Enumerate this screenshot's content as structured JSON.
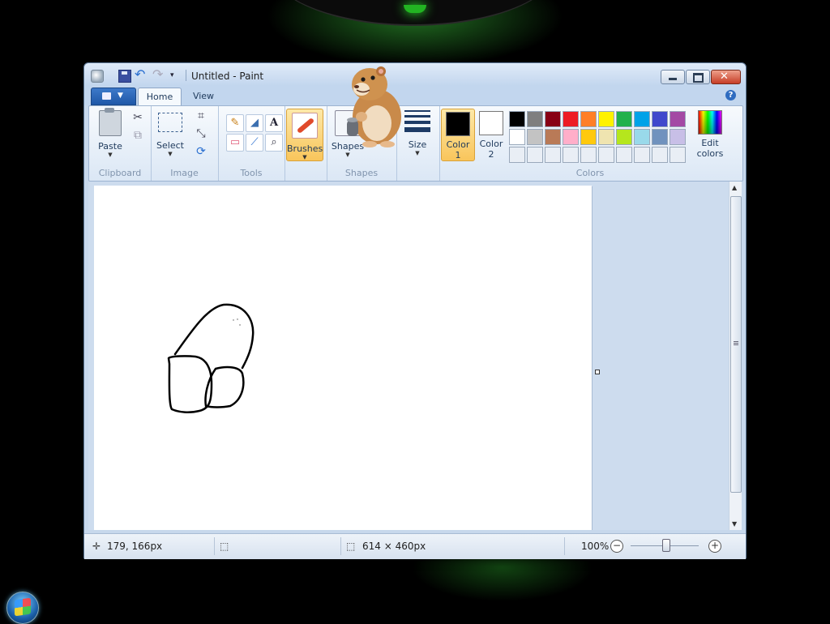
{
  "window": {
    "title": "Untitled - Paint",
    "close_glyph": "✕"
  },
  "quick_access": {
    "undo_icon": "↶",
    "redo_icon": "↷",
    "dropdown_icon": "▾"
  },
  "tabs": [
    {
      "label": "Home",
      "active": true
    },
    {
      "label": "View",
      "active": false
    }
  ],
  "help_label": "?",
  "ribbon": {
    "clipboard": {
      "group_label": "Clipboard",
      "paste_label": "Paste",
      "cut_icon": "✂",
      "copy_icon": "⧉"
    },
    "image": {
      "group_label": "Image",
      "select_label": "Select",
      "crop_icon": "⌗",
      "resize_icon": "⤡",
      "rotate_icon": "⟳"
    },
    "tools": {
      "group_label": "Tools",
      "pencil_icon": "✎",
      "fill_icon": "◢",
      "text_icon": "A",
      "eraser_icon": "▭",
      "picker_icon": "⟋",
      "magnifier_icon": "⌕"
    },
    "brushes_label": "Brushes",
    "shapes": {
      "group_label": "Shapes",
      "button_label": "Shapes"
    },
    "size_label": "Size",
    "colors": {
      "group_label": "Colors",
      "color1_label_line1": "Color",
      "color1_label_line2": "1",
      "color2_label_line1": "Color",
      "color2_label_line2": "2",
      "color1_value": "#000000",
      "color2_value": "#ffffff",
      "edit_label_line1": "Edit",
      "edit_label_line2": "colors",
      "palette_row1": [
        "#000000",
        "#7f7f7f",
        "#880015",
        "#ed1c24",
        "#ff7f27",
        "#fff200",
        "#22b14c",
        "#00a2e8",
        "#3f48cc",
        "#a349a4"
      ],
      "palette_row2": [
        "#ffffff",
        "#c3c3c3",
        "#b97a57",
        "#ffaec9",
        "#ffc90e",
        "#efe4b0",
        "#b5e61d",
        "#99d9ea",
        "#7092be",
        "#c8bfe7"
      ],
      "palette_row3": [
        "#e9eef5",
        "#e9eef5",
        "#e9eef5",
        "#e9eef5",
        "#e9eef5",
        "#e9eef5",
        "#e9eef5",
        "#e9eef5",
        "#e9eef5",
        "#e9eef5"
      ]
    }
  },
  "status": {
    "cursor_icon": "✛",
    "cursor_pos": "179, 166px",
    "selection_icon": "⬚",
    "size_icon": "⬚",
    "canvas_size": "614 × 460px",
    "zoom": "100%",
    "zoom_minus": "−",
    "zoom_plus": "+"
  }
}
